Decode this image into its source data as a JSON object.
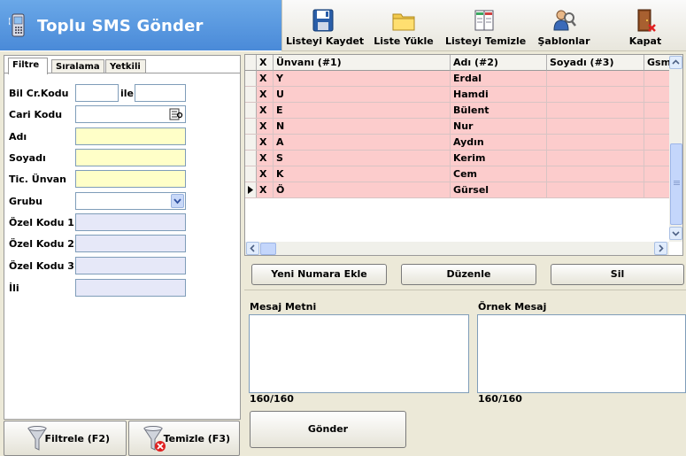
{
  "header": {
    "title": "Toplu SMS Gönder"
  },
  "toolbar": {
    "save": "Listeyi Kaydet",
    "load": "Liste Yükle",
    "clear": "Listeyi Temizle",
    "templates": "Şablonlar",
    "close": "Kapat"
  },
  "tabs": [
    "Filtre",
    "Sıralama",
    "Yetkili"
  ],
  "filter": {
    "bil_cr_kodu": "Bil Cr.Kodu",
    "ile": "ile",
    "cari_kodu": "Cari Kodu",
    "adi": "Adı",
    "soyadi": "Soyadı",
    "tic_unvan": "Tic. Ünvan",
    "grubu": "Grubu",
    "ozel1": "Özel Kodu 1",
    "ozel2": "Özel Kodu 2",
    "ozel3": "Özel Kodu 3",
    "ili": "İli"
  },
  "left_buttons": {
    "filter": "Filtrele (F2)",
    "clear": "Temizle (F3)"
  },
  "grid": {
    "columns": [
      "X",
      "Ünvanı (#1)",
      "Adı (#2)",
      "Soyadı (#3)",
      "Gsm"
    ],
    "rows": [
      {
        "x": "X",
        "unvan": "Y",
        "adi": "Erdal",
        "soyadi": ""
      },
      {
        "x": "X",
        "unvan": "U",
        "adi": "Hamdi",
        "soyadi": ""
      },
      {
        "x": "X",
        "unvan": "E",
        "adi": "Bülent",
        "soyadi": ""
      },
      {
        "x": "X",
        "unvan": "N",
        "adi": "Nur",
        "soyadi": ""
      },
      {
        "x": "X",
        "unvan": "A",
        "adi": "Aydın",
        "soyadi": ""
      },
      {
        "x": "X",
        "unvan": "S",
        "adi": "Kerim",
        "soyadi": ""
      },
      {
        "x": "X",
        "unvan": "K",
        "adi": "Cem",
        "soyadi": ""
      },
      {
        "x": "X",
        "unvan": "Ö",
        "adi": "Gürsel",
        "soyadi": ""
      }
    ]
  },
  "actions": {
    "add": "Yeni Numara Ekle",
    "edit": "Düzenle",
    "delete": "Sil"
  },
  "message": {
    "text_label": "Mesaj Metni",
    "sample_label": "Örnek Mesaj",
    "text_count": "160/160",
    "sample_count": "160/160",
    "send": "Gönder"
  }
}
